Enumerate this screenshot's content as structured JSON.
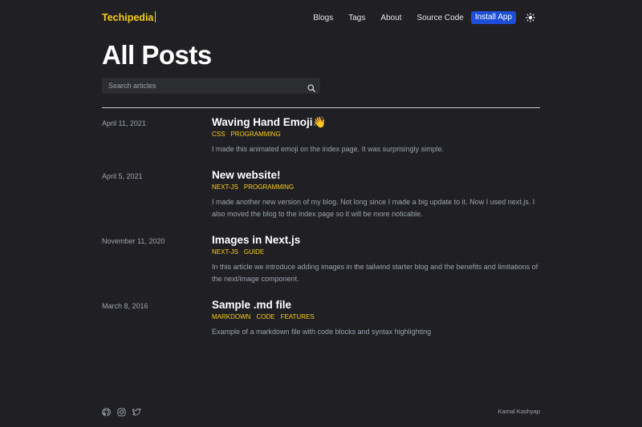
{
  "brand": {
    "name": "Techipedia"
  },
  "nav": [
    {
      "label": "Blogs"
    },
    {
      "label": "Tags"
    },
    {
      "label": "About"
    },
    {
      "label": "Source Code"
    }
  ],
  "install_label": "Install App",
  "theme_icon": "sun-icon",
  "page_title": "All Posts",
  "search": {
    "placeholder": "Search articles",
    "value": "",
    "icon": "search-icon"
  },
  "posts": [
    {
      "date": "April 11, 2021",
      "title": "Waving Hand Emoji👋",
      "tags": [
        "CSS",
        "PROGRAMMING"
      ],
      "summary": "I made this animated emoji on the index page. It was surprisingly simple."
    },
    {
      "date": "April 5, 2021",
      "title": "New website!",
      "tags": [
        "NEXT-JS",
        "PROGRAMMING"
      ],
      "summary": "I made another new version of my blog. Not long since I made a big update to it. Now I used next.js. I also moved the blog to the index page so it will be more noticable."
    },
    {
      "date": "November 11, 2020",
      "title": "Images in Next.js",
      "tags": [
        "NEXT-JS",
        "GUIDE"
      ],
      "summary": "In this article we introduce adding images in the tailwind starter blog and the benefits and limitations of the next/image component."
    },
    {
      "date": "March 8, 2016",
      "title": "Sample .md file",
      "tags": [
        "MARKDOWN",
        "CODE",
        "FEATURES"
      ],
      "summary": "Example of a markdown file with code blocks and syntax highlighting"
    }
  ],
  "footer": {
    "icons": [
      "github-icon",
      "instagram-icon",
      "twitter-icon"
    ],
    "author": "Kamal Kashyap"
  },
  "colors": {
    "background": "#202024",
    "accent": "#facc15",
    "button": "#1d4ed8"
  }
}
